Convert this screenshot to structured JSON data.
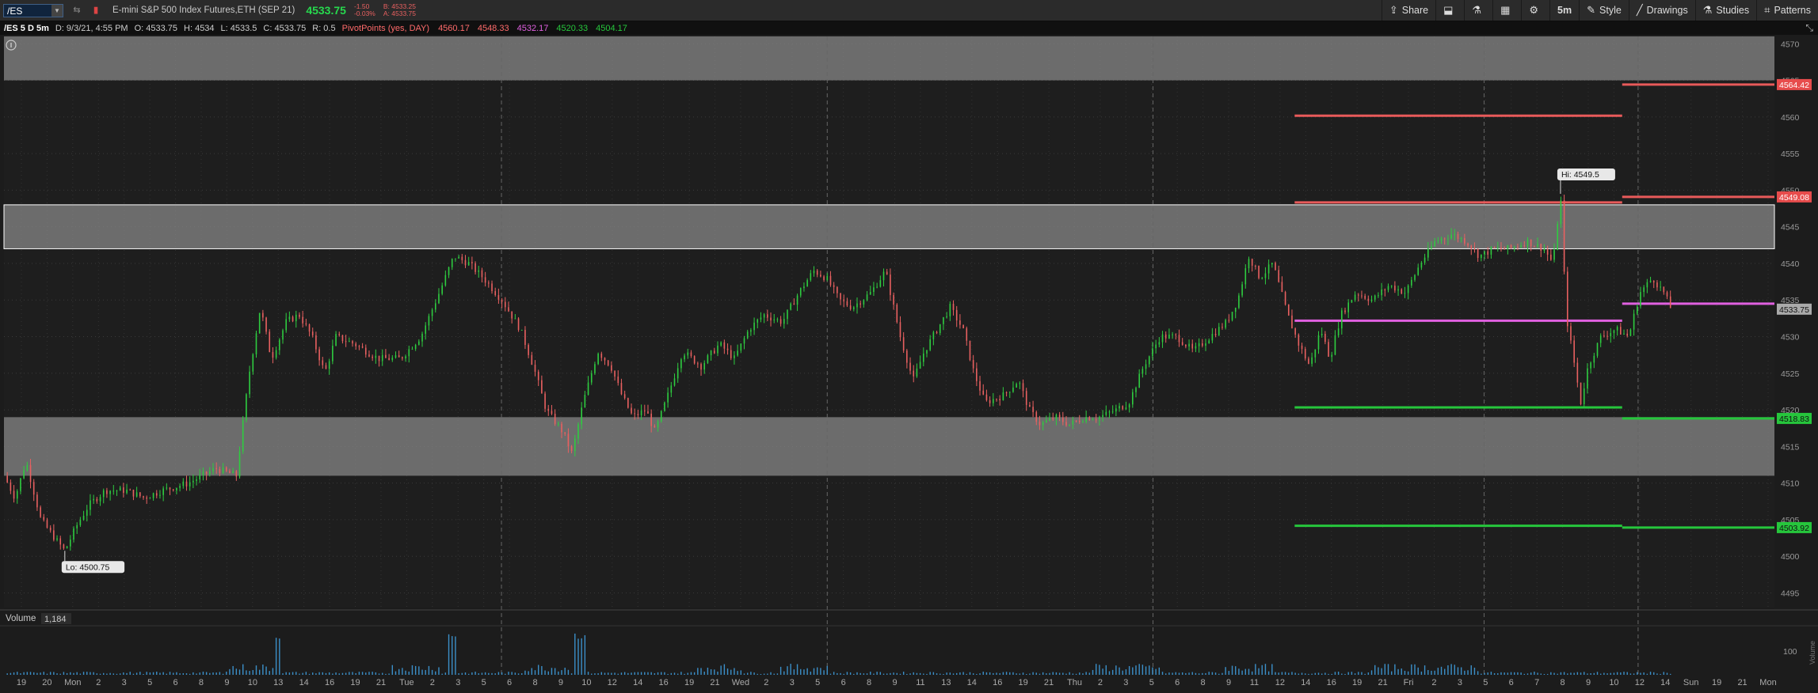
{
  "toolbar": {
    "symbol": "/ES",
    "instrument": "E-mini S&P 500 Index Futures,ETH (SEP 21)",
    "last": "4533.75",
    "change": "-1.50",
    "change_pct": "-0.03%",
    "bid": "B: 4533.25",
    "ask": "A: 4533.75",
    "share": "Share",
    "timeframe": "5m",
    "style": "Style",
    "drawings": "Drawings",
    "studies": "Studies",
    "patterns": "Patterns"
  },
  "infobar": {
    "title": "/ES 5 D 5m",
    "date": "D: 9/3/21, 4:55 PM",
    "open": "O: 4533.75",
    "high": "H: 4534",
    "low": "L: 4533.5",
    "close": "C: 4533.75",
    "range": "R: 0.5",
    "study": "PivotPoints (yes, DAY)",
    "pivots": [
      {
        "value": "4560.17",
        "color": "#ff6b6b"
      },
      {
        "value": "4548.33",
        "color": "#ff6b6b"
      },
      {
        "value": "4532.17",
        "color": "#e060e0"
      },
      {
        "value": "4520.33",
        "color": "#26c63c"
      },
      {
        "value": "4504.17",
        "color": "#26c63c"
      }
    ]
  },
  "volume_pane": {
    "label": "Volume",
    "value": "1,184",
    "tick": "100",
    "side_label": "Volume"
  },
  "chart_data": {
    "type": "candlestick",
    "symbol": "/ES",
    "timeframe": "5m",
    "ylim": [
      4493,
      4571
    ],
    "y_ticks": [
      4495,
      4500,
      4505,
      4510,
      4515,
      4520,
      4525,
      4530,
      4535,
      4540,
      4545,
      4550,
      4555,
      4560,
      4565,
      4570
    ],
    "x_labels": [
      "19",
      "20",
      "Mon",
      "2",
      "3",
      "5",
      "6",
      "8",
      "9",
      "10",
      "13",
      "14",
      "16",
      "19",
      "21",
      "Tue",
      "2",
      "3",
      "5",
      "6",
      "8",
      "9",
      "10",
      "12",
      "14",
      "16",
      "19",
      "21",
      "Wed",
      "2",
      "3",
      "5",
      "6",
      "8",
      "9",
      "11",
      "13",
      "14",
      "16",
      "19",
      "21",
      "Thu",
      "2",
      "3",
      "5",
      "6",
      "8",
      "9",
      "11",
      "12",
      "14",
      "16",
      "19",
      "21",
      "Fri",
      "2",
      "3",
      "5",
      "6",
      "7",
      "8",
      "9",
      "10",
      "12",
      "14",
      "Sun",
      "19",
      "21",
      "Mon"
    ],
    "price_path": [
      {
        "t": 0.0,
        "p": 4511
      },
      {
        "t": 0.6,
        "p": 4508
      },
      {
        "t": 1.2,
        "p": 4513
      },
      {
        "t": 2.0,
        "p": 4505
      },
      {
        "t": 2.9,
        "p": 4502
      },
      {
        "t": 3.3,
        "p": 4500.75
      },
      {
        "t": 3.9,
        "p": 4504
      },
      {
        "t": 4.6,
        "p": 4507
      },
      {
        "t": 5.5,
        "p": 4509
      },
      {
        "t": 6.6,
        "p": 4509
      },
      {
        "t": 7.6,
        "p": 4508
      },
      {
        "t": 8.6,
        "p": 4509
      },
      {
        "t": 10.0,
        "p": 4510
      },
      {
        "t": 11.5,
        "p": 4512
      },
      {
        "t": 12.6,
        "p": 4511
      },
      {
        "t": 13.3,
        "p": 4525
      },
      {
        "t": 13.9,
        "p": 4534
      },
      {
        "t": 14.5,
        "p": 4527
      },
      {
        "t": 15.3,
        "p": 4532
      },
      {
        "t": 16.0,
        "p": 4533
      },
      {
        "t": 16.7,
        "p": 4530
      },
      {
        "t": 17.4,
        "p": 4525
      },
      {
        "t": 18.0,
        "p": 4530
      },
      {
        "t": 19.0,
        "p": 4529
      },
      {
        "t": 20.3,
        "p": 4527
      },
      {
        "t": 21.5,
        "p": 4527
      },
      {
        "t": 22.6,
        "p": 4530
      },
      {
        "t": 23.6,
        "p": 4536
      },
      {
        "t": 24.4,
        "p": 4541
      },
      {
        "t": 25.2,
        "p": 4540
      },
      {
        "t": 26.0,
        "p": 4538
      },
      {
        "t": 27.0,
        "p": 4535
      },
      {
        "t": 28.0,
        "p": 4531
      },
      {
        "t": 28.7,
        "p": 4526
      },
      {
        "t": 29.4,
        "p": 4520
      },
      {
        "t": 30.3,
        "p": 4517
      },
      {
        "t": 30.8,
        "p": 4514
      },
      {
        "t": 31.4,
        "p": 4521
      },
      {
        "t": 32.2,
        "p": 4528
      },
      {
        "t": 32.9,
        "p": 4526
      },
      {
        "t": 33.5,
        "p": 4522
      },
      {
        "t": 34.1,
        "p": 4519
      },
      {
        "t": 34.8,
        "p": 4520
      },
      {
        "t": 35.3,
        "p": 4517
      },
      {
        "t": 36.0,
        "p": 4522
      },
      {
        "t": 36.8,
        "p": 4528
      },
      {
        "t": 37.8,
        "p": 4526
      },
      {
        "t": 38.8,
        "p": 4529
      },
      {
        "t": 39.6,
        "p": 4527
      },
      {
        "t": 40.4,
        "p": 4531
      },
      {
        "t": 41.2,
        "p": 4533
      },
      {
        "t": 42.2,
        "p": 4532
      },
      {
        "t": 43.1,
        "p": 4536
      },
      {
        "t": 43.9,
        "p": 4539
      },
      {
        "t": 44.6,
        "p": 4538
      },
      {
        "t": 45.3,
        "p": 4535
      },
      {
        "t": 46.0,
        "p": 4534
      },
      {
        "t": 47.0,
        "p": 4536
      },
      {
        "t": 47.8,
        "p": 4539
      },
      {
        "t": 48.6,
        "p": 4530
      },
      {
        "t": 49.3,
        "p": 4524
      },
      {
        "t": 49.9,
        "p": 4528
      },
      {
        "t": 50.6,
        "p": 4531
      },
      {
        "t": 51.3,
        "p": 4534
      },
      {
        "t": 52.0,
        "p": 4531
      },
      {
        "t": 52.6,
        "p": 4525
      },
      {
        "t": 53.2,
        "p": 4521
      },
      {
        "t": 54.2,
        "p": 4522
      },
      {
        "t": 55.0,
        "p": 4524
      },
      {
        "t": 55.6,
        "p": 4520
      },
      {
        "t": 56.2,
        "p": 4518
      },
      {
        "t": 57.0,
        "p": 4519
      },
      {
        "t": 57.8,
        "p": 4518
      },
      {
        "t": 58.6,
        "p": 4519
      },
      {
        "t": 59.4,
        "p": 4519
      },
      {
        "t": 60.3,
        "p": 4520
      },
      {
        "t": 61.0,
        "p": 4521
      },
      {
        "t": 61.8,
        "p": 4526
      },
      {
        "t": 62.7,
        "p": 4530
      },
      {
        "t": 63.6,
        "p": 4530
      },
      {
        "t": 64.5,
        "p": 4528
      },
      {
        "t": 65.4,
        "p": 4530
      },
      {
        "t": 66.3,
        "p": 4532
      },
      {
        "t": 66.9,
        "p": 4535
      },
      {
        "t": 67.5,
        "p": 4541
      },
      {
        "t": 68.1,
        "p": 4538
      },
      {
        "t": 68.8,
        "p": 4540
      },
      {
        "t": 69.6,
        "p": 4533
      },
      {
        "t": 70.2,
        "p": 4529
      },
      {
        "t": 70.8,
        "p": 4526
      },
      {
        "t": 71.4,
        "p": 4531
      },
      {
        "t": 71.9,
        "p": 4527
      },
      {
        "t": 72.5,
        "p": 4533
      },
      {
        "t": 73.3,
        "p": 4536
      },
      {
        "t": 74.2,
        "p": 4535
      },
      {
        "t": 75.1,
        "p": 4537
      },
      {
        "t": 76.0,
        "p": 4536
      },
      {
        "t": 76.8,
        "p": 4540
      },
      {
        "t": 77.6,
        "p": 4543
      },
      {
        "t": 78.5,
        "p": 4544
      },
      {
        "t": 79.3,
        "p": 4543
      },
      {
        "t": 80.0,
        "p": 4541
      },
      {
        "t": 80.8,
        "p": 4542
      },
      {
        "t": 81.6,
        "p": 4542
      },
      {
        "t": 82.6,
        "p": 4543
      },
      {
        "t": 83.5,
        "p": 4542
      },
      {
        "t": 84.0,
        "p": 4540
      },
      {
        "t": 84.4,
        "p": 4549.5
      },
      {
        "t": 84.7,
        "p": 4533
      },
      {
        "t": 85.1,
        "p": 4527
      },
      {
        "t": 85.5,
        "p": 4521
      },
      {
        "t": 85.9,
        "p": 4526
      },
      {
        "t": 86.6,
        "p": 4530
      },
      {
        "t": 87.4,
        "p": 4531
      },
      {
        "t": 88.1,
        "p": 4530
      },
      {
        "t": 88.7,
        "p": 4536
      },
      {
        "t": 89.4,
        "p": 4538
      },
      {
        "t": 90.0,
        "p": 4536
      },
      {
        "t": 90.4,
        "p": 4533.75
      }
    ],
    "high_label": "Hi: 4549.5",
    "low_label": "Lo: 4500.75",
    "zones": [
      {
        "from": 4565,
        "to": 4571
      },
      {
        "from": 4542,
        "to": 4548
      },
      {
        "from": 4511,
        "to": 4519
      }
    ],
    "pivot_lines": [
      {
        "value": 4560.17,
        "color": "#e85a5a",
        "session": "fri"
      },
      {
        "value": 4548.33,
        "color": "#e85a5a",
        "session": "fri"
      },
      {
        "value": 4532.17,
        "color": "#e060e0",
        "session": "fri"
      },
      {
        "value": 4520.33,
        "color": "#26c63c",
        "session": "fri"
      },
      {
        "value": 4504.17,
        "color": "#26c63c",
        "session": "fri"
      },
      {
        "value": 4564.42,
        "color": "#e85a5a",
        "session": "next"
      },
      {
        "value": 4549.08,
        "color": "#e85a5a",
        "session": "next"
      },
      {
        "value": 4534.5,
        "color": "#e060e0",
        "session": "next"
      },
      {
        "value": 4518.83,
        "color": "#26c63c",
        "session": "next"
      },
      {
        "value": 4503.92,
        "color": "#26c63c",
        "session": "next"
      }
    ],
    "axis_tags": [
      {
        "text": "4564.42",
        "value": 4564.42,
        "bg": "#e74c4c",
        "fg": "#ffffff"
      },
      {
        "text": "4549.08",
        "value": 4549.08,
        "bg": "#e74c4c",
        "fg": "#ffffff"
      },
      {
        "text": "4533.75",
        "value": 4533.75,
        "bg": "#aaaaaa",
        "fg": "#111111"
      },
      {
        "text": "4518.83",
        "value": 4518.83,
        "bg": "#26c63c",
        "fg": "#111111"
      },
      {
        "text": "4503.92",
        "value": 4503.92,
        "bg": "#26c63c",
        "fg": "#111111"
      }
    ],
    "colors": {
      "up": "#2ecc40",
      "down": "#e86060",
      "zone": "#8a8a8a",
      "volume": "#3b8fc8"
    }
  }
}
